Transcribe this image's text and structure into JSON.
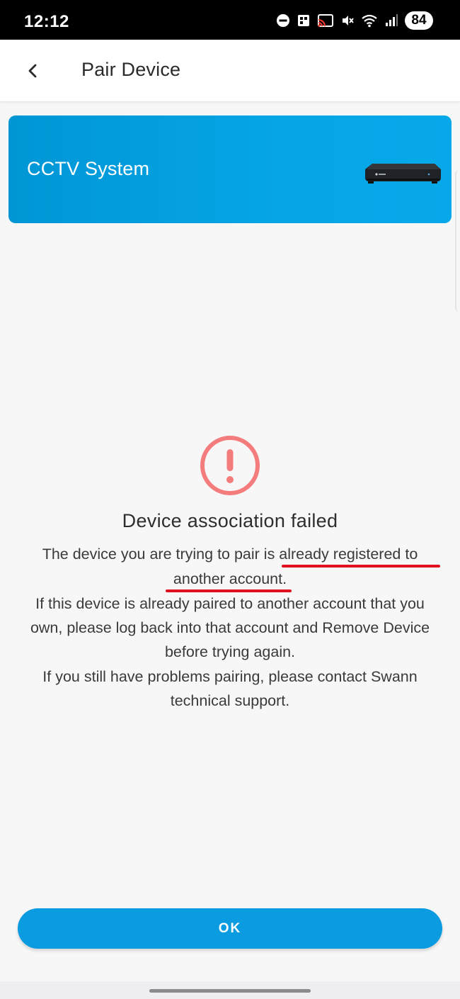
{
  "status_bar": {
    "time": "12:12",
    "battery": "84",
    "icons": [
      "do-not-disturb-icon",
      "notification-icon",
      "cast-icon",
      "mute-icon",
      "wifi-icon",
      "signal-icon"
    ]
  },
  "app_bar": {
    "back_icon": "chevron-left-icon",
    "title": "Pair Device"
  },
  "device_card": {
    "title": "CCTV System",
    "image": "dvr-recorder-image",
    "gradient_start": "#0096d6",
    "gradient_end": "#06a8e9"
  },
  "error": {
    "icon": "exclamation-circle-icon",
    "icon_color": "#f47c7c",
    "heading": "Device association failed",
    "message_lines": [
      "The device you are trying to pair is already registered to",
      "another account.",
      "If this device is already paired to another account that you",
      "own, please log back into that account and Remove Device",
      "before trying again.",
      "If you still have problems pairing, please contact Swann",
      "technical support."
    ],
    "highlight_color": "#e0101e"
  },
  "actions": {
    "ok_label": "OK",
    "ok_color": "#0a9be0"
  }
}
